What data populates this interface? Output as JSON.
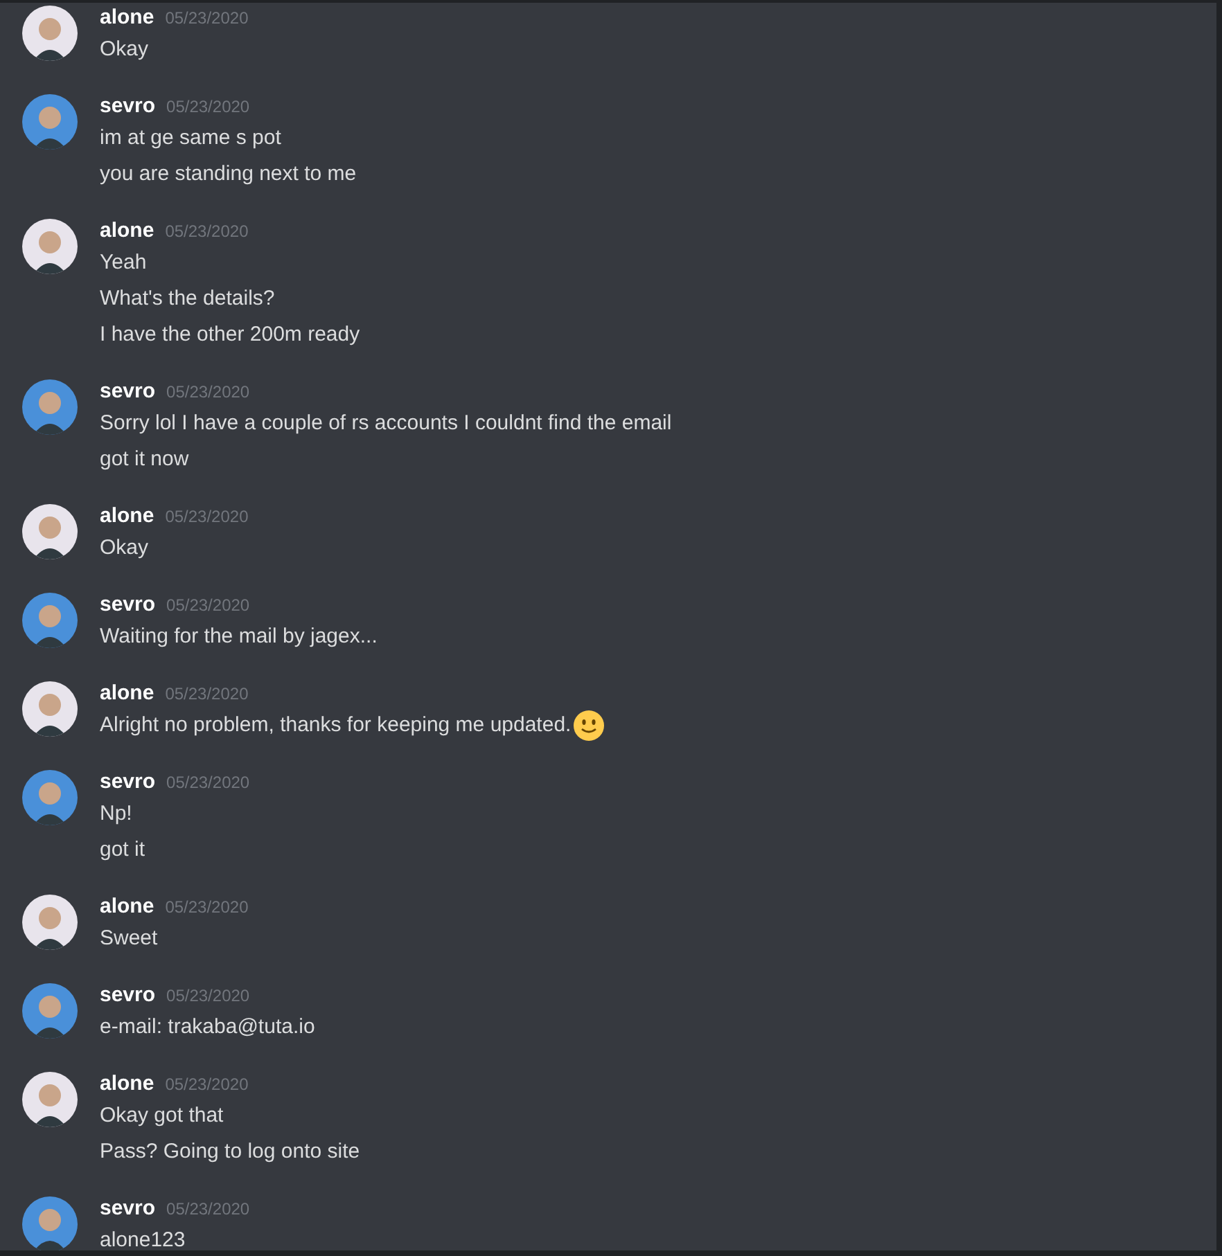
{
  "groups": [
    {
      "author": "alone",
      "color": "#e8e4ec",
      "date": "05/23/2020",
      "messages": [
        {
          "text": "Okay"
        }
      ]
    },
    {
      "author": "sevro",
      "color": "#4a90d9",
      "date": "05/23/2020",
      "messages": [
        {
          "text": "im at ge same s pot"
        },
        {
          "text": "you are standing next to me"
        }
      ]
    },
    {
      "author": "alone",
      "color": "#e8e4ec",
      "date": "05/23/2020",
      "messages": [
        {
          "text": "Yeah"
        },
        {
          "text": "What's the details?"
        },
        {
          "text": "I have the other 200m ready"
        }
      ]
    },
    {
      "author": "sevro",
      "color": "#4a90d9",
      "date": "05/23/2020",
      "messages": [
        {
          "text": "Sorry lol I have a couple of rs accounts I couldnt find the email"
        },
        {
          "text": "got it now"
        }
      ]
    },
    {
      "author": "alone",
      "color": "#e8e4ec",
      "date": "05/23/2020",
      "messages": [
        {
          "text": "Okay"
        }
      ]
    },
    {
      "author": "sevro",
      "color": "#4a90d9",
      "date": "05/23/2020",
      "messages": [
        {
          "text": "Waiting for the mail by jagex..."
        }
      ]
    },
    {
      "author": "alone",
      "color": "#e8e4ec",
      "date": "05/23/2020",
      "messages": [
        {
          "text": "Alright no problem, thanks for keeping me updated.",
          "kind": "text_with_emoji"
        }
      ]
    },
    {
      "author": "sevro",
      "color": "#4a90d9",
      "date": "05/23/2020",
      "messages": [
        {
          "text": "Np!"
        },
        {
          "text": "got it"
        }
      ]
    },
    {
      "author": "alone",
      "color": "#e8e4ec",
      "date": "05/23/2020",
      "messages": [
        {
          "text": "Sweet"
        }
      ]
    },
    {
      "author": "sevro",
      "color": "#4a90d9",
      "date": "05/23/2020",
      "messages": [
        {
          "text": "e-mail: trakaba@tuta.io"
        }
      ]
    },
    {
      "author": "alone",
      "color": "#e8e4ec",
      "date": "05/23/2020",
      "messages": [
        {
          "text": "Okay got that"
        },
        {
          "text": "Pass? Going to log onto site"
        }
      ]
    },
    {
      "author": "sevro",
      "color": "#4a90d9",
      "date": "05/23/2020",
      "messages": [
        {
          "text": "alone123"
        }
      ]
    }
  ]
}
